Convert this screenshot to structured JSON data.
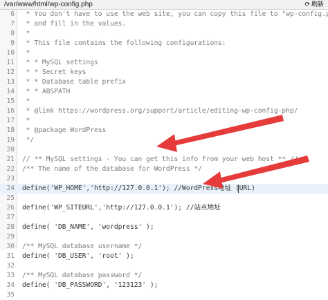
{
  "toolbar": {
    "file_path": "/var/www/html/wp-config.php",
    "refresh_label": "刷新"
  },
  "editor": {
    "active_line": 24,
    "lines": [
      {
        "num": "6",
        "text": " * You don't have to use the web site, you can copy this file to \"wp-config.php\"",
        "kind": "comment"
      },
      {
        "num": "7",
        "text": " * and fill in the values.",
        "kind": "comment"
      },
      {
        "num": "8",
        "text": " *",
        "kind": "comment"
      },
      {
        "num": "9",
        "text": " * This file contains the following configurations:",
        "kind": "comment"
      },
      {
        "num": "10",
        "text": " *",
        "kind": "comment"
      },
      {
        "num": "11",
        "text": " * * MySQL settings",
        "kind": "comment"
      },
      {
        "num": "12",
        "text": " * * Secret keys",
        "kind": "comment"
      },
      {
        "num": "13",
        "text": " * * Database table prefix",
        "kind": "comment"
      },
      {
        "num": "14",
        "text": " * * ABSPATH",
        "kind": "comment"
      },
      {
        "num": "15",
        "text": " *",
        "kind": "comment"
      },
      {
        "num": "16",
        "text": " * @link https://wordpress.org/support/article/editing-wp-config-php/",
        "kind": "comment"
      },
      {
        "num": "17",
        "text": " *",
        "kind": "comment"
      },
      {
        "num": "18",
        "text": " * @package WordPress",
        "kind": "comment"
      },
      {
        "num": "19",
        "text": " */",
        "kind": "comment"
      },
      {
        "num": "20",
        "text": "",
        "kind": "code"
      },
      {
        "num": "21",
        "text": "// ** MySQL settings - You can get this info from your web host ** //",
        "kind": "comment"
      },
      {
        "num": "22",
        "text": "/** The name of the database for WordPress */",
        "kind": "comment"
      },
      {
        "num": "23",
        "text": "",
        "kind": "code"
      },
      {
        "num": "24",
        "text": "define('WP_HOME','http://127.0.0.1'); //WordPress地址 (URL)",
        "kind": "code"
      },
      {
        "num": "25",
        "text": "",
        "kind": "code"
      },
      {
        "num": "26",
        "text": "define('WP_SITEURL','http://127.0.0.1'); //站点地址",
        "kind": "code"
      },
      {
        "num": "27",
        "text": "",
        "kind": "code"
      },
      {
        "num": "28",
        "text": "define( 'DB_NAME', 'wordpress' );",
        "kind": "code"
      },
      {
        "num": "29",
        "text": "",
        "kind": "code"
      },
      {
        "num": "30",
        "text": "/** MySQL database username */",
        "kind": "comment"
      },
      {
        "num": "31",
        "text": "define( 'DB_USER', 'root' );",
        "kind": "code"
      },
      {
        "num": "32",
        "text": "",
        "kind": "code"
      },
      {
        "num": "33",
        "text": "/** MySQL database password */",
        "kind": "comment"
      },
      {
        "num": "34",
        "text": "define( 'DB_PASSWORD', '123123' );",
        "kind": "code"
      },
      {
        "num": "35",
        "text": "",
        "kind": "code"
      }
    ]
  },
  "annotations": {
    "arrow_color": "#e63b3b"
  }
}
